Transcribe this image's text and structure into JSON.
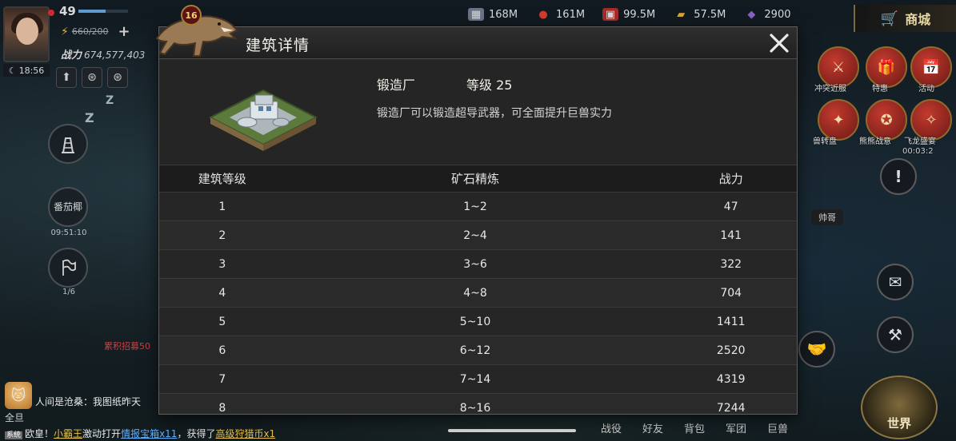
{
  "hud": {
    "level": "49",
    "clock": "18:56",
    "energy": "660/200",
    "power_label": "战力",
    "power_value": "674,577,403",
    "left_buttons": [
      {
        "label": "",
        "sub": ""
      },
      {
        "label": "番茄椰",
        "sub": "09:51:10"
      },
      {
        "label": "",
        "sub": "1/6"
      }
    ],
    "recruit_text": "累积招募50"
  },
  "resources": [
    {
      "icon": "steel-icon",
      "value": "168M",
      "color": "#8a8fa8"
    },
    {
      "icon": "food-icon",
      "value": "161M",
      "color": "#d33a2c"
    },
    {
      "icon": "crate-icon",
      "value": "99.5M",
      "color": "#b3332e"
    },
    {
      "icon": "gold-icon",
      "value": "57.5M",
      "color": "#d9a534"
    },
    {
      "icon": "gem-icon",
      "value": "2900",
      "color": "#8b5fc7"
    }
  ],
  "shop": {
    "label": "商城"
  },
  "right_icons": [
    {
      "label": "冲突近服"
    },
    {
      "label": "特惠"
    },
    {
      "label": "活动"
    },
    {
      "label": "兽转盘"
    },
    {
      "label": "熊熊战意"
    },
    {
      "label": "飞龙盛宴"
    }
  ],
  "right_timer": "00:03:2",
  "hint_badge": "帅哥",
  "modal": {
    "title": "建筑详情",
    "badge": "16",
    "building_name": "锻造厂",
    "building_level": "等级 25",
    "description": "锻造厂可以锻造超导武器，可全面提升巨兽实力",
    "columns": [
      "建筑等级",
      "矿石精炼",
      "战力"
    ],
    "rows": [
      {
        "level": "1",
        "refine": "1~2",
        "power": "47"
      },
      {
        "level": "2",
        "refine": "2~4",
        "power": "141"
      },
      {
        "level": "3",
        "refine": "3~6",
        "power": "322"
      },
      {
        "level": "4",
        "refine": "4~8",
        "power": "704"
      },
      {
        "level": "5",
        "refine": "5~10",
        "power": "1411"
      },
      {
        "level": "6",
        "refine": "6~12",
        "power": "2520"
      },
      {
        "level": "7",
        "refine": "7~14",
        "power": "4319"
      },
      {
        "level": "8",
        "refine": "8~16",
        "power": "7244"
      }
    ]
  },
  "chat": {
    "line1": "人间是沧桑：我图纸昨天",
    "tag": "全旦",
    "sys_tag": "系统",
    "line2_prefix": "欧皇！",
    "line2_name": "小霸王",
    "line2_mid": "激动打开",
    "line2_item": "情报宝箱x11",
    "line2_mid2": "，获得了",
    "line2_reward": "高级狩猎币x1"
  },
  "bottom_nav": [
    "战役",
    "好友",
    "背包",
    "军团",
    "巨兽"
  ],
  "world": {
    "label": "世界"
  }
}
